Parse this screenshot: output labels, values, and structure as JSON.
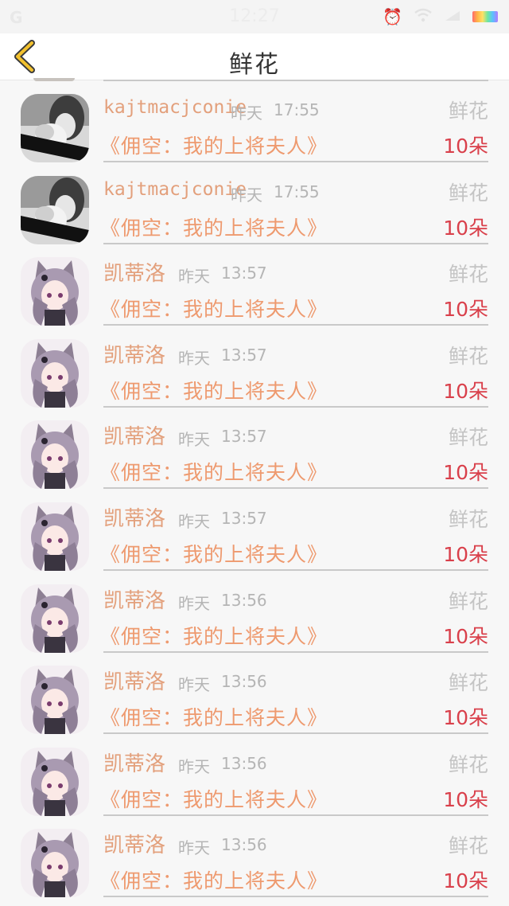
{
  "status_bar": {
    "carrier": "G",
    "time": "12:27"
  },
  "header": {
    "title": "鲜花"
  },
  "rows": [
    {
      "avatar": "photo",
      "username": "kajtmacjconie",
      "day": "昨天",
      "time": "17:55",
      "gift": "鲜花",
      "book": "《佣空：我的上将夫人》",
      "amount": "10朵"
    },
    {
      "avatar": "photo",
      "username": "kajtmacjconie",
      "day": "昨天",
      "time": "17:55",
      "gift": "鲜花",
      "book": "《佣空：我的上将夫人》",
      "amount": "10朵"
    },
    {
      "avatar": "anime",
      "username": "凯蒂洛",
      "day": "昨天",
      "time": "13:57",
      "gift": "鲜花",
      "book": "《佣空：我的上将夫人》",
      "amount": "10朵"
    },
    {
      "avatar": "anime",
      "username": "凯蒂洛",
      "day": "昨天",
      "time": "13:57",
      "gift": "鲜花",
      "book": "《佣空：我的上将夫人》",
      "amount": "10朵"
    },
    {
      "avatar": "anime",
      "username": "凯蒂洛",
      "day": "昨天",
      "time": "13:57",
      "gift": "鲜花",
      "book": "《佣空：我的上将夫人》",
      "amount": "10朵"
    },
    {
      "avatar": "anime",
      "username": "凯蒂洛",
      "day": "昨天",
      "time": "13:57",
      "gift": "鲜花",
      "book": "《佣空：我的上将夫人》",
      "amount": "10朵"
    },
    {
      "avatar": "anime",
      "username": "凯蒂洛",
      "day": "昨天",
      "time": "13:56",
      "gift": "鲜花",
      "book": "《佣空：我的上将夫人》",
      "amount": "10朵"
    },
    {
      "avatar": "anime",
      "username": "凯蒂洛",
      "day": "昨天",
      "time": "13:56",
      "gift": "鲜花",
      "book": "《佣空：我的上将夫人》",
      "amount": "10朵"
    },
    {
      "avatar": "anime",
      "username": "凯蒂洛",
      "day": "昨天",
      "time": "13:56",
      "gift": "鲜花",
      "book": "《佣空：我的上将夫人》",
      "amount": "10朵"
    },
    {
      "avatar": "anime",
      "username": "凯蒂洛",
      "day": "昨天",
      "time": "13:56",
      "gift": "鲜花",
      "book": "《佣空：我的上将夫人》",
      "amount": "10朵"
    }
  ]
}
